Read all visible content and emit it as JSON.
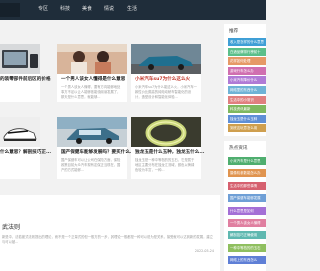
{
  "nav": {
    "items": [
      "专区",
      "科技",
      "美食",
      "情说",
      "生活"
    ]
  },
  "cards": [
    {
      "title": "的装零部件前后区的价格",
      "snippet": "",
      "thumb": "devices-icon"
    },
    {
      "title": "一个男人该女人懂得是什么意思",
      "snippet": "一个男人该女人懂得，要有方向能够地处事方不足以让人能够依能领阅读发展了，那天是什么意思，就能够...",
      "thumb": "people-icon"
    },
    {
      "title": "小米汽车su7为什么这么火",
      "snippet": "小米汽车su7为什么能这么火，小米汽车一款性价比颇高的纯电动轿车智能化的设计，造型设计和智能化体验...",
      "thumb": "car-icon"
    },
    {
      "title": "什么意思？解剖技巧正...",
      "snippet": "",
      "thumb": "shoes-icon"
    },
    {
      "title": "国产保健车能够发展吗？要买什么...",
      "snippet": "国产保健车可以让公司在保险方面，保险政策目前大众汽车现有定保正当现在，国产的方式能够...",
      "thumb": "vehicle-icon"
    },
    {
      "title": "独龙玉是什么玉种，独龙玉什么...",
      "snippet": "独龙玉是一种中等档的的玉石，它是属于地区主要分布在独龙江流域，颜色以黄绿色较为丰富，一种...",
      "thumb": "jade-icon"
    }
  ],
  "section": {
    "title": "武法则",
    "body": "新是中，法若被式法则提出的理论，而不是一个正量式的但一般方的一步，其理论一般都是一种可以说为是关系，接受就可以达到新的发展，建立与可以被...",
    "date": "2022-05-24"
  },
  "sidebar": {
    "recommend_title": "推荐",
    "recommend_tags": [
      {
        "label": "收入是怎样的什么意思",
        "color": "#3f9fd6"
      },
      {
        "label": "白酒品牌排行榜前十",
        "color": "#5bbf8a"
      },
      {
        "label": "花样如何处理",
        "color": "#e69966"
      },
      {
        "label": "游戏行车怎么办",
        "color": "#d06fb0"
      },
      {
        "label": "小米汽车降价什么",
        "color": "#b07bd6"
      },
      {
        "label": "网络里的东西什么",
        "color": "#6fb3d6"
      },
      {
        "label": "生活中的小常识",
        "color": "#e07f7f"
      },
      {
        "label": "科技资讯最新",
        "color": "#7fb85f"
      },
      {
        "label": "独龙玉是什么玉种",
        "color": "#5f8fd6"
      },
      {
        "label": "到底这玩意怎么用",
        "color": "#cf9f4f"
      }
    ],
    "hot_title": "热点资讯",
    "hot_tags": [
      {
        "label": "小米汽车是什么意思",
        "color": "#4fae6f"
      },
      {
        "label": "摄像机参数能怎么办",
        "color": "#e0944f"
      },
      {
        "label": "生活中的那些事情",
        "color": "#d6606f"
      },
      {
        "label": "国产保健车能够发展",
        "color": "#6f9fd6"
      },
      {
        "label": "什么意思是如何",
        "color": "#a46fd6"
      },
      {
        "label": "一个男人该女人懂得",
        "color": "#e07fa0"
      },
      {
        "label": "解剖技巧正确使用",
        "color": "#5fb8b0"
      },
      {
        "label": "一种中等档的的玉石",
        "color": "#8fbf5f"
      },
      {
        "label": "网络上的东西怎么",
        "color": "#5f7fd6"
      }
    ]
  }
}
